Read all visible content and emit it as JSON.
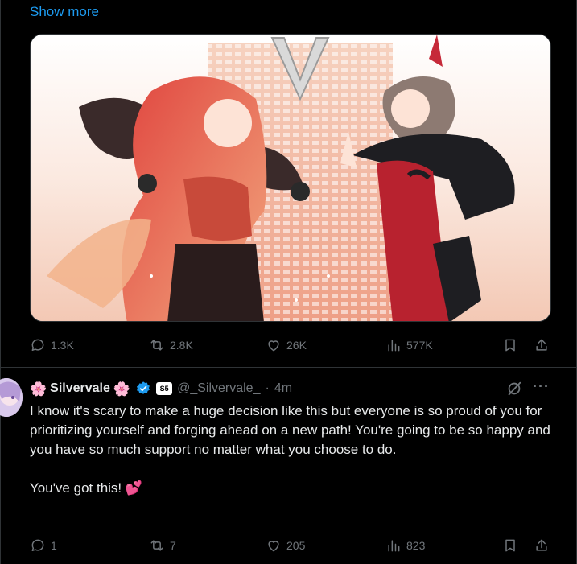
{
  "show_more": "Show more",
  "tweet1": {
    "reply_count": "1.3K",
    "repost_count": "2.8K",
    "like_count": "26K",
    "view_count": "577K"
  },
  "tweet2": {
    "display_name": "Silvervale",
    "name_emoji_left": "🌸",
    "name_emoji_right": "🌸",
    "affiliate_badge": "S5",
    "handle": "@_Silvervale_",
    "separator": "·",
    "time": "4m",
    "paragraph1": "I know it's scary to make a huge decision like this but everyone is so proud of you for prioritizing yourself and forging ahead on a new path! You're going to be so happy and you have so much support no matter what you choose to do.",
    "paragraph2": "You've got this!",
    "paragraph2_emoji": "💕",
    "reply_count": "1",
    "repost_count": "7",
    "like_count": "205",
    "view_count": "823",
    "more_label": "···"
  },
  "colors": {
    "accent": "#1d9bf0",
    "muted": "#71767b",
    "text": "#e7e9ea",
    "background": "#000000",
    "border": "#2f3336"
  },
  "icons": [
    "reply-icon",
    "repost-icon",
    "like-icon",
    "views-icon",
    "bookmark-icon",
    "share-icon",
    "verified-icon",
    "grok-icon",
    "more-icon"
  ]
}
